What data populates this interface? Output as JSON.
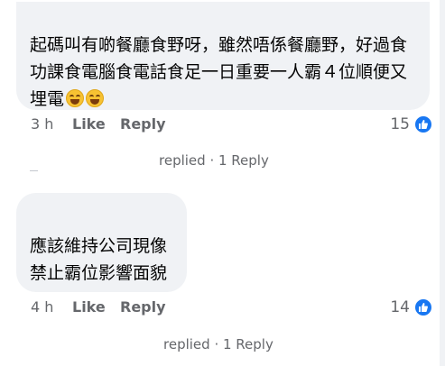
{
  "comments": [
    {
      "text": "起碼叫有啲餐廳食野呀，雖然唔係餐廳野，好過食功課食電腦食電話食足一日重要一人霸４位順便又埋電",
      "emoji": [
        "grinning-squinting-face",
        "grinning-squinting-face"
      ],
      "time": "3 h",
      "like_label": "Like",
      "reply_label": "Reply",
      "reaction_count": "15",
      "reaction_icon": "thumbs-up-icon",
      "replies_label": "replied · 1 Reply"
    },
    {
      "text": "應該維持公司現像禁止霸位影響面貌",
      "time": "4 h",
      "like_label": "Like",
      "reply_label": "Reply",
      "reaction_count": "14",
      "reaction_icon": "thumbs-up-icon",
      "replies_label": "replied · 1 Reply"
    }
  ],
  "colors": {
    "bubble": "#f0f2f5",
    "text": "#050505",
    "meta": "#65676b",
    "like_blue": "#1877f2"
  }
}
